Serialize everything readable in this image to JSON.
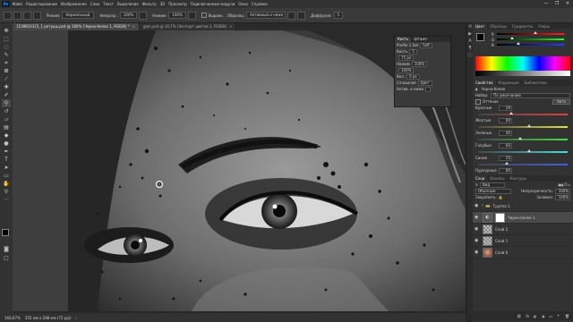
{
  "app": {
    "logo": "Ps"
  },
  "menu": [
    "Файл",
    "Редактирование",
    "Изображение",
    "Слои",
    "Текст",
    "Выделение",
    "Фильтр",
    "3D",
    "Просмотр",
    "Подключаемые модули",
    "Окно",
    "Справка"
  ],
  "window_controls": [
    "—",
    "❐",
    "✕"
  ],
  "options": {
    "mode_label": "Режим:",
    "mode_value": "Нормальный",
    "opacity_label": "Непрозр.:",
    "opacity_value": "100%",
    "flow_label": "Нажим:",
    "flow_value": "100%",
    "smooth_label": "Сглаж.:",
    "smooth_value": "10%",
    "aligned_label": "Выравн.",
    "sample_label": "Образец:",
    "sample_value": "Активный и ниже",
    "diffusion_label": "Диффузия:",
    "diffusion_value": "5"
  },
  "tabs": [
    {
      "label": "1539810315_1 ретушь.psd @ 166% (Черно-белое 1, RGB/8) *",
      "active": true
    },
    {
      "label": "gam.psd @ 16,7% (Экспорт цветов 1, RGB/8)",
      "active": false
    }
  ],
  "status": {
    "zoom": "166,67%",
    "doc_size": "355 мм x 288 мм (72 ppi)"
  },
  "brush_panel": {
    "tabs": [
      "Кисть",
      "Штамп"
    ],
    "rows": [
      {
        "label": "Profile 1 Set",
        "value": "Soft"
      },
      {
        "label": "Кисть",
        "value": "5"
      },
      {
        "label": "",
        "value": "75 px"
      },
      {
        "label": "Нажим",
        "value": "100%"
      },
      {
        "label": "",
        "value": "100%"
      },
      {
        "label": "Вкл.",
        "value": "0 px"
      },
      {
        "label": "Сплошная",
        "value": "Цвет"
      },
      {
        "label": "Актив. и ниже",
        "value": ""
      }
    ]
  },
  "right": {
    "color_tabs": [
      "Цвет",
      "Образцы",
      "Градиенты",
      "Узоры"
    ],
    "color_sliders": [
      {
        "name": "R",
        "value": "",
        "color": "#d63a3a",
        "pos": 0.55
      },
      {
        "name": "G",
        "value": "",
        "color": "#3ab04a",
        "pos": 0.2
      },
      {
        "name": "B",
        "value": "",
        "color": "#3a6ad6",
        "pos": 0.3
      }
    ],
    "props_tabs": [
      "Свойства",
      "Коррекция",
      "Библиотеки"
    ],
    "props_title": "Черно-белое",
    "preset_label": "Набор:",
    "preset_value": "По умолчанию",
    "tint_label": "Оттенок",
    "auto_label": "Авто",
    "bw_sliders": [
      {
        "name": "Красные",
        "value": "29",
        "grad": "linear-gradient(90deg,#444,#e04040)",
        "pos": 0.35
      },
      {
        "name": "Желтые",
        "value": "60",
        "grad": "linear-gradient(90deg,#444,#e0e040)",
        "pos": 0.55
      },
      {
        "name": "Зеленые",
        "value": "40",
        "grad": "linear-gradient(90deg,#444,#40e040)",
        "pos": 0.45
      },
      {
        "name": "Голубые",
        "value": "60",
        "grad": "linear-gradient(90deg,#444,#40e0e0)",
        "pos": 0.55
      },
      {
        "name": "Синие",
        "value": "20",
        "grad": "linear-gradient(90deg,#444,#4060e0)",
        "pos": 0.3
      },
      {
        "name": "Пурпурные",
        "value": "80",
        "grad": "linear-gradient(90deg,#444,#e040e0)",
        "pos": 0.65
      }
    ],
    "layers_tabs": [
      "Слои",
      "Каналы",
      "Контуры"
    ],
    "filter_label": "Вид",
    "blend_value": "Обычные",
    "opacity_label": "Непрозрачность:",
    "opacity_value": "100%",
    "lock_label": "Закрепить:",
    "fill_label": "Заливка:",
    "fill_value": "100%",
    "layers": [
      {
        "name": "Группа 1",
        "kind": "group",
        "selected": false
      },
      {
        "name": "Черно-белое 1",
        "kind": "adjust",
        "selected": true
      },
      {
        "name": "Слой 2",
        "kind": "pixel",
        "selected": false
      },
      {
        "name": "Слой 1",
        "kind": "pixel",
        "selected": false
      },
      {
        "name": "Слой 0",
        "kind": "photo",
        "selected": false
      }
    ],
    "bottom_icons": [
      "⛓",
      "fx",
      "◐",
      "◑",
      "▭",
      "＋",
      "🗑"
    ]
  },
  "tools": [
    "move",
    "marquee",
    "lasso",
    "quick-select",
    "crop",
    "frame",
    "eyedropper",
    "healing",
    "brush",
    "clone-stamp",
    "history-brush",
    "eraser",
    "gradient",
    "blur",
    "dodge",
    "pen",
    "type",
    "path-select",
    "rectangle",
    "hand",
    "zoom",
    "more"
  ]
}
